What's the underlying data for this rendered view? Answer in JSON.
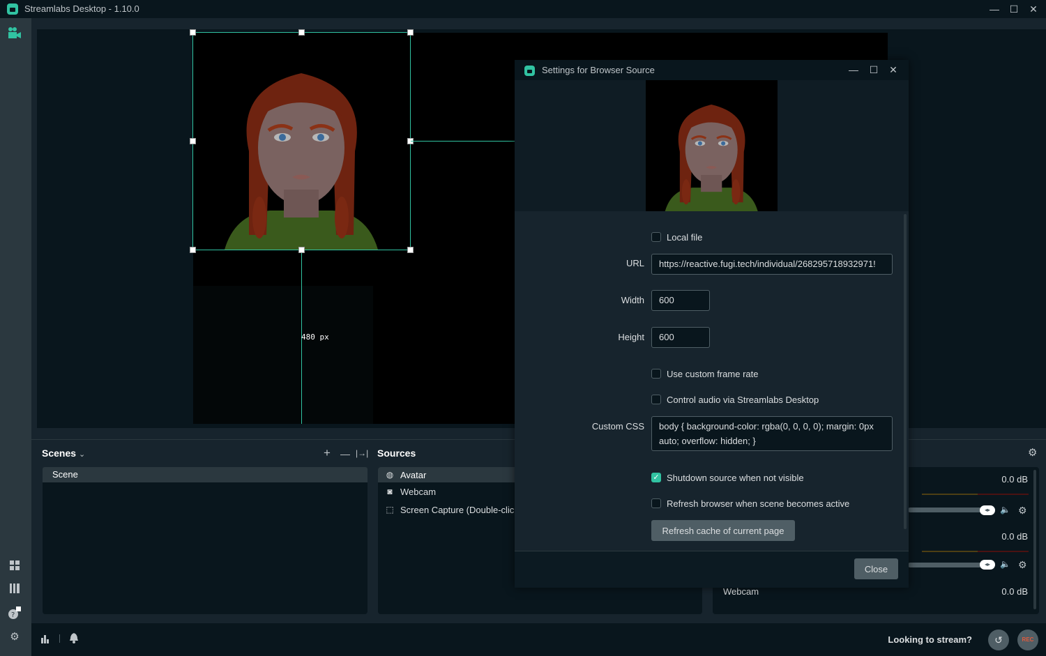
{
  "app": {
    "title": "Streamlabs Desktop - 1.10.0",
    "brand_color": "#31c3a2",
    "window_controls": {
      "minimize": "—",
      "maximize": "☐",
      "close": "✕"
    }
  },
  "sidebar": {
    "top_icon": "studio-camera-icon",
    "bottom_icons": [
      "layout-icon",
      "columns-icon",
      "help-icon",
      "settings-icon"
    ]
  },
  "editor": {
    "measure_label": "480 px"
  },
  "scenes": {
    "title": "Scenes",
    "chevron": "⌄",
    "add": "+",
    "remove": "—",
    "transition": "|→|",
    "items": [
      "Scene"
    ]
  },
  "sources": {
    "title": "Sources",
    "items": [
      {
        "label": "Avatar",
        "icon": "globe-icon",
        "glyph": "◍"
      },
      {
        "label": "Webcam",
        "icon": "webcam-icon",
        "glyph": "◙"
      },
      {
        "label": "Screen Capture (Double-click",
        "icon": "screen-capture-icon",
        "glyph": "⬚"
      }
    ]
  },
  "mixer": {
    "settings_glyph": "⚙",
    "channels": [
      {
        "name": "",
        "db": "0.0 dB"
      },
      {
        "name": "",
        "db": "0.0 dB"
      },
      {
        "name": "Webcam",
        "db": "0.0 dB"
      }
    ],
    "speaker_glyph": "🔈",
    "knob_glyph": "◂▸"
  },
  "footer": {
    "looking_to_stream": "Looking to stream?",
    "replay_glyph": "↺",
    "rec_label": "REC",
    "rec_color": "#e25b3d"
  },
  "dialog": {
    "title": "Settings for Browser Source",
    "controls": {
      "minimize": "—",
      "maximize": "☐",
      "close": "✕"
    },
    "fields": {
      "local_file": {
        "label": "Local file",
        "checked": false
      },
      "url": {
        "label": "URL",
        "value": "https://reactive.fugi.tech/individual/268295718932971!"
      },
      "width": {
        "label": "Width",
        "value": "600"
      },
      "height": {
        "label": "Height",
        "value": "600"
      },
      "custom_frame_rate": {
        "label": "Use custom frame rate",
        "checked": false
      },
      "control_audio": {
        "label": "Control audio via Streamlabs Desktop",
        "checked": false
      },
      "custom_css": {
        "label": "Custom CSS",
        "value": "body { background-color: rgba(0, 0, 0, 0); margin: 0px auto; overflow: hidden; }"
      },
      "shutdown": {
        "label": "Shutdown source when not visible",
        "checked": true,
        "check_glyph": "✓"
      },
      "refresh_on_active": {
        "label": "Refresh browser when scene becomes active",
        "checked": false
      }
    },
    "refresh_cache_button": "Refresh cache of current page",
    "close_button": "Close"
  }
}
